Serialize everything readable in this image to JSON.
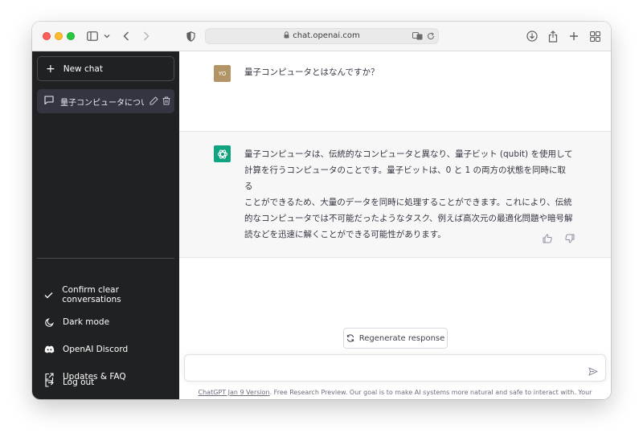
{
  "browser": {
    "url": "chat.openai.com",
    "icons": [
      "sidebar-icon",
      "chevron-down-icon",
      "back-icon",
      "forward-icon",
      "shield-icon",
      "lock-icon",
      "translate-icon",
      "reload-icon",
      "download-icon",
      "share-icon",
      "new-tab-icon",
      "tab-overview-icon"
    ]
  },
  "sidebar": {
    "new_chat_label": "New chat",
    "conversations": [
      {
        "title": "量子コンピュータについ"
      }
    ],
    "links": [
      {
        "label": "Confirm clear conversations",
        "icon": "check-icon"
      },
      {
        "label": "Dark mode",
        "icon": "moon-icon"
      },
      {
        "label": "OpenAI Discord",
        "icon": "discord-icon"
      },
      {
        "label": "Updates & FAQ",
        "icon": "external-link-icon"
      },
      {
        "label": "Log out",
        "icon": "logout-icon"
      }
    ]
  },
  "chat": {
    "user_avatar": "YO",
    "user_message": "量子コンピュータとはなんですか？",
    "ai_message_lines": [
      "量子コンピュータは、伝統的なコンピュータと異なり、量子ビット (qubit) を使用して",
      "計算を行うコンピュータのことです。量子ビットは、0 と 1 の両方の状態を同時に取る",
      "ことができるため、大量のデータを同時に処理することができます。これにより、伝統",
      "的なコンピュータでは不可能だったようなタスク、例えば高次元の最適化問題や暗号解",
      "読などを迅速に解くことができる可能性があります。"
    ],
    "regenerate_label": "Regenerate response",
    "input_placeholder": "",
    "footer_link": "ChatGPT Jan 9 Version",
    "footer_text": ". Free Research Preview. Our goal is to make AI systems more natural and safe to interact with. Your feedback will help us improve."
  },
  "colors": {
    "sidebar_bg": "#202123",
    "accent": "#10a37f",
    "user_avatar_bg": "#b39466",
    "ai_row_bg": "#f7f7f8"
  }
}
